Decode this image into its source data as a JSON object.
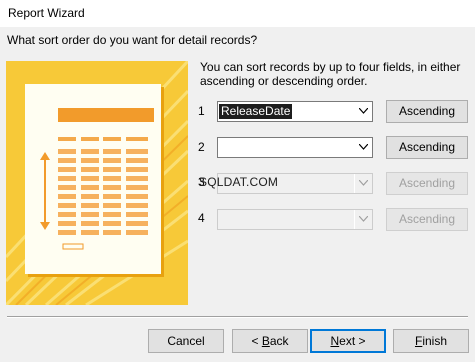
{
  "window": {
    "title": "Report Wizard"
  },
  "question": "What sort order do you want for detail records?",
  "description": "You can sort records by up to four fields, in either ascending or descending order.",
  "sort_rows": [
    {
      "number": "1",
      "field": "ReleaseDate",
      "order": "Ascending",
      "enabled": true
    },
    {
      "number": "2",
      "field": "",
      "order": "Ascending",
      "enabled": true
    },
    {
      "number": "3",
      "field": "",
      "order": "Ascending",
      "enabled": false
    },
    {
      "number": "4",
      "field": "",
      "order": "Ascending",
      "enabled": false
    }
  ],
  "watermark": "SQLDAT.COM",
  "footer": {
    "cancel": "Cancel",
    "back_mnemonic": "B",
    "back_rest": "ack",
    "back_prefix": "< ",
    "next_mnemonic": "N",
    "next_rest": "ext >",
    "finish_mnemonic": "F",
    "finish_rest": "inish"
  },
  "colors": {
    "illustration_bg": "#f7c938",
    "illustration_accent": "#f29b2b",
    "default_button_border": "#0078d7"
  },
  "icons": {
    "dropdown": "chevron-down-icon",
    "illustration": "report-illustration"
  }
}
